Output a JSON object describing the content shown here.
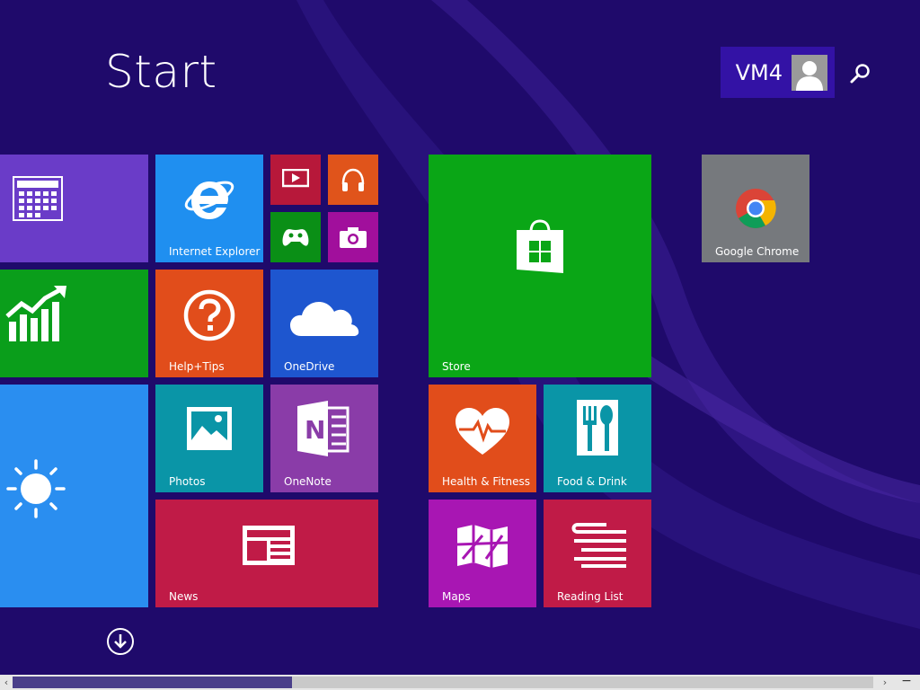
{
  "screen": {
    "title": "Start"
  },
  "user": {
    "name": "VM4"
  },
  "tiles": {
    "calendar": {
      "label": "",
      "color": "#6a3cc8"
    },
    "finance": {
      "label": "",
      "color": "#0a9e1b"
    },
    "weather": {
      "label": "",
      "color": "#2a8ef0"
    },
    "internet_explorer": {
      "label": "Internet Explorer",
      "color": "#1f8ff0"
    },
    "video": {
      "label": "",
      "color": "#b7183a"
    },
    "music": {
      "label": "",
      "color": "#e0541b"
    },
    "games": {
      "label": "",
      "color": "#0a8f16"
    },
    "camera": {
      "label": "",
      "color": "#a10f9c"
    },
    "help_tips": {
      "label": "Help+Tips",
      "color": "#e14d1b"
    },
    "onedrive": {
      "label": "OneDrive",
      "color": "#1e56cf"
    },
    "photos": {
      "label": "Photos",
      "color": "#0a95a7"
    },
    "onenote": {
      "label": "OneNote",
      "color": "#8a3ca8"
    },
    "news": {
      "label": "News",
      "color": "#c01b47"
    },
    "store": {
      "label": "Store",
      "color": "#0aa616"
    },
    "health_fitness": {
      "label": "Health & Fitness",
      "color": "#e14d1b"
    },
    "food_drink": {
      "label": "Food & Drink",
      "color": "#0a95a7"
    },
    "maps": {
      "label": "Maps",
      "color": "#a816b3"
    },
    "reading_list": {
      "label": "Reading List",
      "color": "#c01b47"
    },
    "google_chrome": {
      "label": "Google Chrome",
      "color": "#76797d"
    }
  },
  "icons": {
    "search": "search-icon",
    "all_apps": "arrow-down-circle-icon",
    "avatar": "user-avatar-icon"
  },
  "accent": "#1f0a6b"
}
